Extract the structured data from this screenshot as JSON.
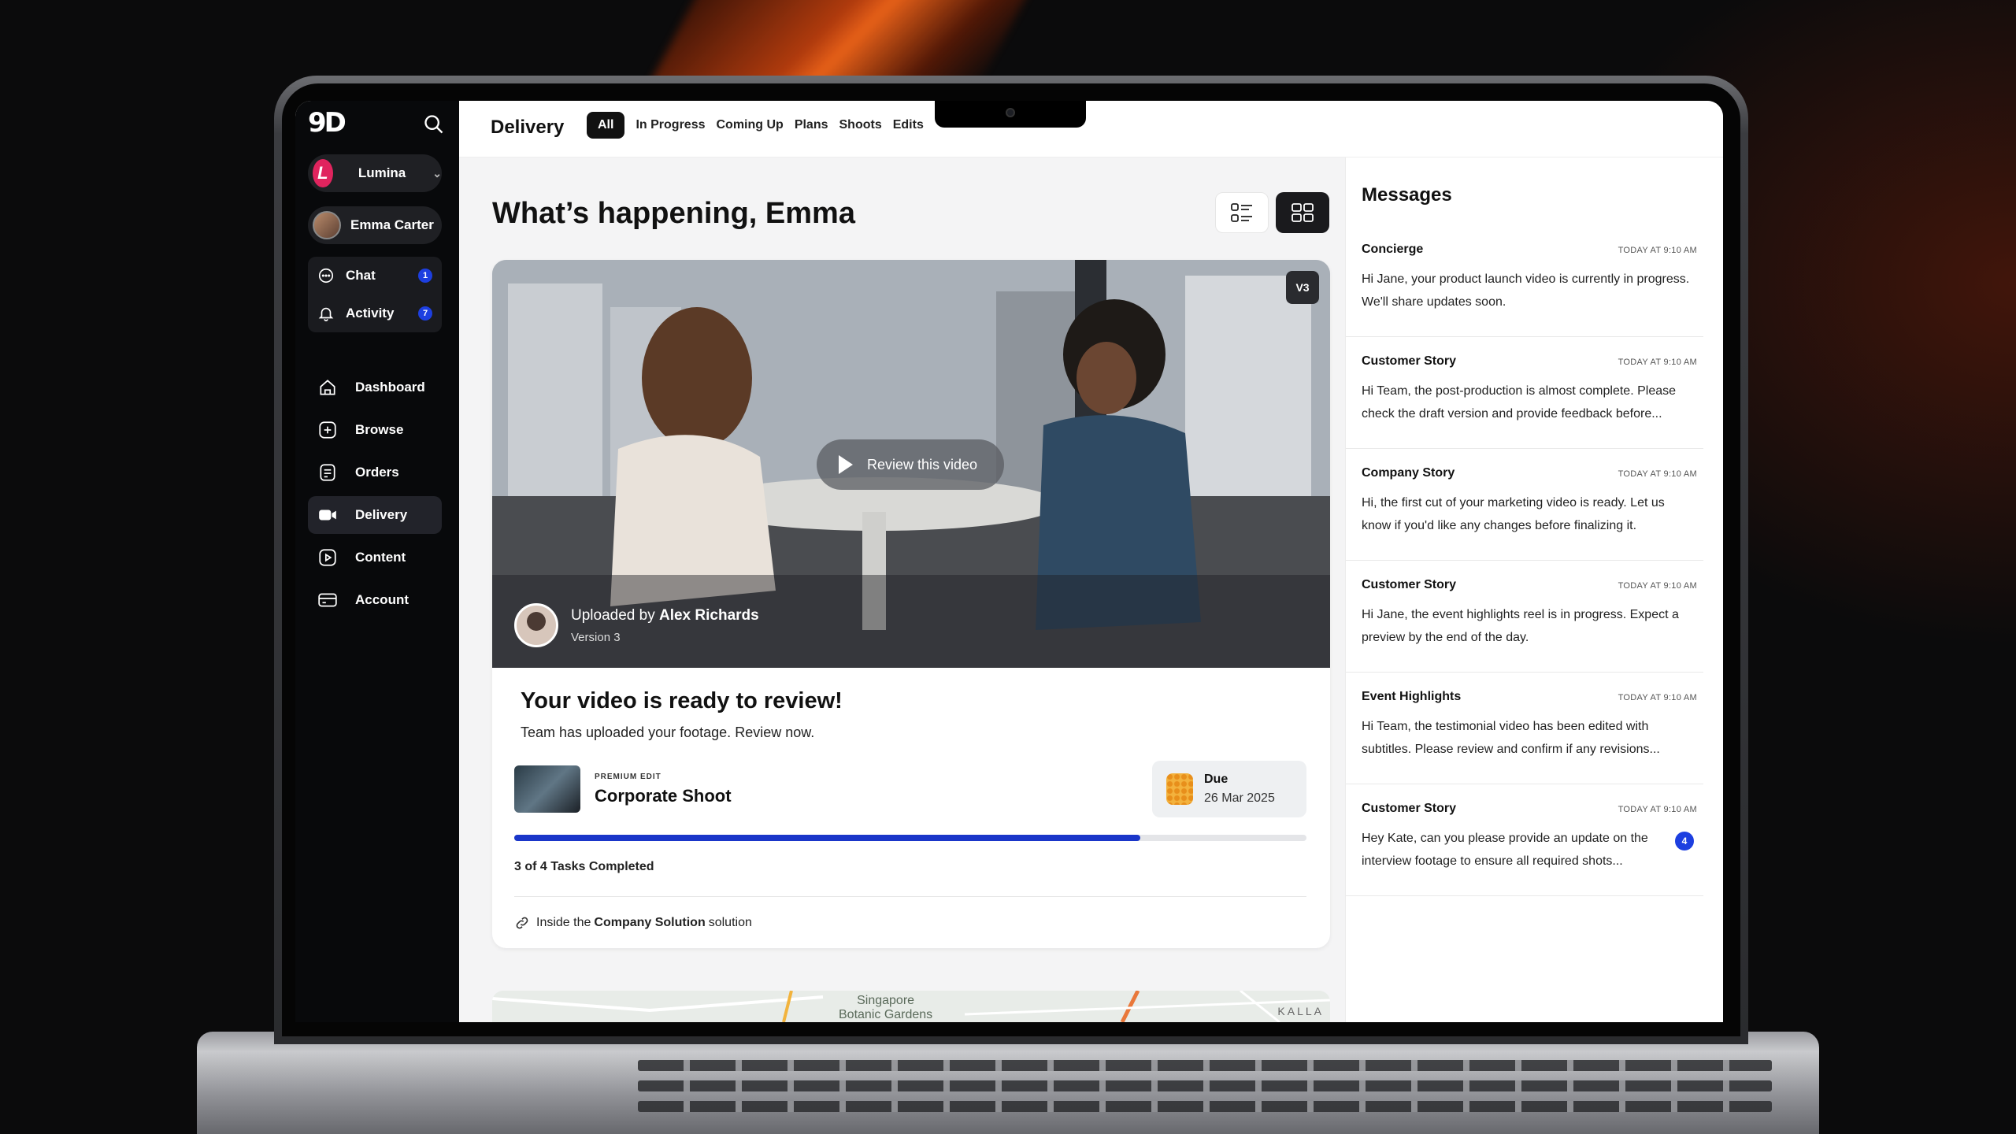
{
  "app": {
    "logo": "9D",
    "org_name": "Lumina",
    "org_initial": "L",
    "user_name": "Emma Carter"
  },
  "sidebar": {
    "quick": [
      {
        "label": "Chat",
        "badge": "1",
        "icon": "chat-icon"
      },
      {
        "label": "Activity",
        "badge": "7",
        "icon": "bell-icon"
      }
    ],
    "nav": [
      {
        "label": "Dashboard",
        "icon": "home-icon"
      },
      {
        "label": "Browse",
        "icon": "plus-square-icon"
      },
      {
        "label": "Orders",
        "icon": "orders-icon"
      },
      {
        "label": "Delivery",
        "icon": "video-camera-icon",
        "active": true
      },
      {
        "label": "Content",
        "icon": "play-square-icon"
      },
      {
        "label": "Account",
        "icon": "card-icon"
      }
    ]
  },
  "header": {
    "title": "Delivery",
    "tabs": [
      "All",
      "In Progress",
      "Coming Up",
      "Plans",
      "Shoots",
      "Edits"
    ],
    "active_tab": "All"
  },
  "main": {
    "greeting": "What’s happening, Emma",
    "card": {
      "version_badge": "V3",
      "review_label": "Review this video",
      "uploaded_prefix": "Uploaded by",
      "uploader": "Alex Richards",
      "version": "Version 3",
      "title": "Your video is ready to review!",
      "subtitle": "Team has uploaded your footage. Review now.",
      "project_tag": "PREMIUM EDIT",
      "project_name": "Corporate Shoot",
      "due_label": "Due",
      "due_date": "26 Mar 2025",
      "progress_fraction": 0.79,
      "tasks_text": "3 of 4 Tasks Completed",
      "solution_prefix": "Inside the",
      "solution_name": "Company Solution",
      "solution_suffix": "solution"
    },
    "map": {
      "label_line1": "Singapore",
      "label_line2": "Botanic Gardens",
      "corner_label": "KALLA"
    }
  },
  "messages": {
    "title": "Messages",
    "items": [
      {
        "sender": "Concierge",
        "time": "TODAY AT 9:10 AM",
        "body": "Hi Jane, your product launch video is currently in progress. We'll share updates soon."
      },
      {
        "sender": "Customer Story",
        "time": "TODAY AT 9:10 AM",
        "body": "Hi Team, the post-production is almost complete. Please check the draft version and provide feedback before..."
      },
      {
        "sender": "Company Story",
        "time": "TODAY AT 9:10 AM",
        "body": "Hi, the first cut of your marketing video is ready. Let us know if you'd like any changes before finalizing it."
      },
      {
        "sender": "Customer Story",
        "time": "TODAY AT 9:10 AM",
        "body": "Hi Jane, the event highlights reel is in progress. Expect a preview by the end of the day."
      },
      {
        "sender": "Event Highlights",
        "time": "TODAY AT 9:10 AM",
        "body": "Hi Team, the testimonial video has been edited with subtitles. Please review and confirm if any revisions..."
      },
      {
        "sender": "Customer Story",
        "time": "TODAY AT 9:10 AM",
        "body": "Hey Kate, can you please provide an update on the interview footage to ensure all required shots...",
        "badge": "4"
      }
    ]
  },
  "colors": {
    "accent": "#1a36c9",
    "sidebar_bg": "#08090b",
    "org_avatar": "#e0245e",
    "due_icon": "#f3b23d"
  }
}
